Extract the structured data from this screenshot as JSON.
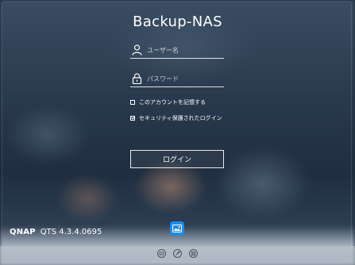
{
  "title": "Backup-NAS",
  "username": {
    "placeholder": "ユーザー名",
    "icon": "user-icon"
  },
  "password": {
    "placeholder": "パスワード",
    "icon": "lock-icon"
  },
  "remember": {
    "label": "このアカウントを記憶する",
    "checked": false
  },
  "secure": {
    "label": "セキュリティ保護されたログイン",
    "checked": true
  },
  "login_button": "ログイン",
  "brand": {
    "logo": "QNAP",
    "version": "QTS 4.3.4.0695"
  },
  "app_icon": "photo-app-icon",
  "bottom_icons": [
    "helpdesk-icon",
    "tools-icon",
    "mobile-icon"
  ],
  "colors": {
    "accent": "#1f8be6",
    "bottom_bar": "#bec6d0"
  }
}
